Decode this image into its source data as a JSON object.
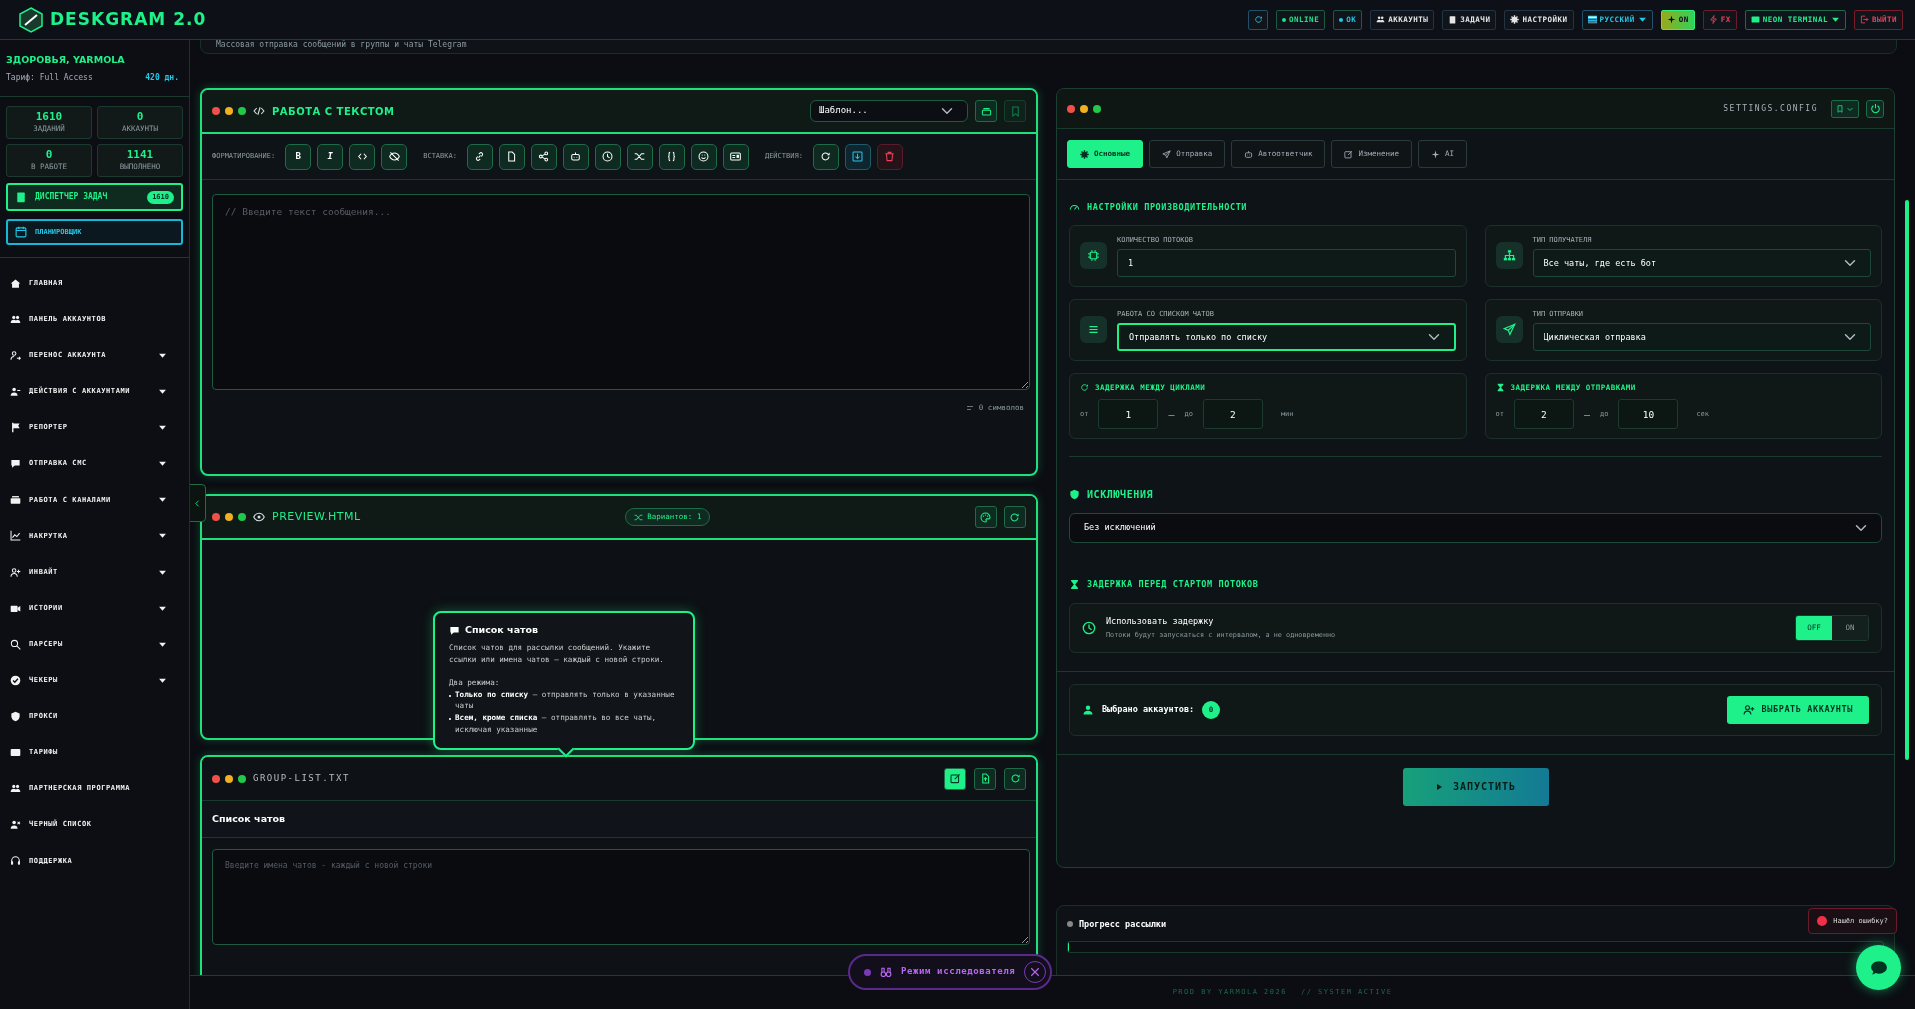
{
  "app": {
    "title": "DESKGRAM 2.0"
  },
  "topbar": [
    {
      "kind": "icon"
    },
    {
      "kind": "status",
      "label": "ONLINE",
      "color": "#22e08a"
    },
    {
      "kind": "status",
      "label": "OK",
      "color": "#22c8e8"
    },
    {
      "kind": "nav",
      "label": "АККАУНТЫ"
    },
    {
      "kind": "nav",
      "label": "ЗАДАЧИ"
    },
    {
      "kind": "nav",
      "label": "НАСТРОЙКИ"
    },
    {
      "kind": "language",
      "label": "РУССКИЙ"
    },
    {
      "kind": "effects",
      "label": "ON"
    },
    {
      "kind": "fx",
      "label": "FX"
    },
    {
      "kind": "theme",
      "label": "NEON TERMINAL"
    },
    {
      "kind": "logout",
      "label": "ВЫЙТИ"
    }
  ],
  "sidebar": {
    "greeting": "ЗДОРОВЬЯ, YARMOLA",
    "plan": "Тариф: Full Access",
    "days": "420 дн.",
    "stats": [
      {
        "value": "1610",
        "label": "ЗАДАНИЙ"
      },
      {
        "value": "0",
        "label": "АККАУНТЫ"
      },
      {
        "value": "0",
        "label": "В РАБОТЕ"
      },
      {
        "value": "1141",
        "label": "ВЫПОЛНЕНО"
      }
    ],
    "task_manager": {
      "label": "ДИСПЕТЧЕР ЗАДАЧ",
      "count": "1610"
    },
    "scheduler": {
      "label": "ПЛАНИРОВЩИК"
    },
    "items": [
      {
        "label": "ГЛАВНАЯ",
        "expandable": false
      },
      {
        "label": "ПАНЕЛЬ АККАУНТОВ",
        "expandable": false
      },
      {
        "label": "ПЕРЕНОС АККАУНТА",
        "expandable": true
      },
      {
        "label": "ДЕЙСТВИЯ С АККАУНТАМИ",
        "expandable": true
      },
      {
        "label": "РЕПОРТЕР",
        "expandable": true
      },
      {
        "label": "ОТПРАВКА СМС",
        "expandable": true
      },
      {
        "label": "РАБОТА С КАНАЛАМИ",
        "expandable": true
      },
      {
        "label": "НАКРУТКА",
        "expandable": true
      },
      {
        "label": "ИНВАЙТ",
        "expandable": true
      },
      {
        "label": "ИСТОРИИ",
        "expandable": true
      },
      {
        "label": "ПАРСЕРЫ",
        "expandable": true
      },
      {
        "label": "ЧЕКЕРЫ",
        "expandable": true
      },
      {
        "label": "ПРОКСИ",
        "expandable": false
      },
      {
        "label": "ТАРИФЫ",
        "expandable": false
      },
      {
        "label": "ПАРТНЕРСКАЯ ПРОГРАММА",
        "expandable": false
      },
      {
        "label": "ЧЕРНЫЙ СПИСОК",
        "expandable": false
      },
      {
        "label": "ПОДДЕРЖКА",
        "expandable": false
      }
    ]
  },
  "page_header": {
    "subtitle": "Массовая отправка сообщений в группы и чаты Telegram"
  },
  "text_panel": {
    "title": "РАБОТА С ТЕКСТОМ",
    "template": "Шаблон...",
    "groups": [
      {
        "label": "ФОРМАТИРОВАНИЕ:",
        "buttons": [
          {
            "kind": "text",
            "label": "B"
          },
          {
            "kind": "text",
            "label": "I"
          },
          {
            "kind": "icon"
          },
          {
            "kind": "icon"
          }
        ]
      },
      {
        "label": "ВСТАВКА:",
        "buttons": [
          {
            "kind": "icon"
          },
          {
            "kind": "icon"
          },
          {
            "kind": "icon"
          },
          {
            "kind": "icon"
          },
          {
            "kind": "icon"
          },
          {
            "kind": "icon"
          },
          {
            "kind": "icon"
          },
          {
            "kind": "icon"
          },
          {
            "kind": "icon"
          }
        ]
      },
      {
        "label": "ДЕЙСТВИЯ:",
        "buttons": [
          {
            "kind": "icon"
          },
          {
            "kind": "icon"
          },
          {
            "kind": "icon"
          }
        ]
      }
    ],
    "placeholder": "// Введите текст сообщения...",
    "counter": "0 символов"
  },
  "preview_panel": {
    "title": "PREVIEW.HTML",
    "variants": "Вариантов: 1"
  },
  "group_list": {
    "title": "GROUP-LIST.TXT",
    "tools": [
      {
        "active": true
      },
      {
        "active": false
      },
      {
        "active": false
      }
    ],
    "heading": "Список чатов",
    "placeholder": "Введите имена чатов - каждый с новой строки"
  },
  "tooltip": {
    "title": "Список чатов",
    "text": "Список чатов для рассылки сообщений. Укажите ссылки или имена чатов — каждый с новой строки.",
    "modes_title": "Два режима:",
    "modes": [
      "**Только по списку** — отправлять только в указанные чаты",
      "**Всем, кроме списка** — отправлять во все чаты, исключая указанные"
    ]
  },
  "settings": {
    "title": "SETTINGS.CONFIG",
    "tabs": [
      {
        "label": "Основные",
        "selected": true
      },
      {
        "label": "Отправка",
        "selected": false
      },
      {
        "label": "Автоответчик",
        "selected": false
      },
      {
        "label": "Изменение",
        "selected": false
      },
      {
        "label": "AI",
        "selected": false
      }
    ],
    "performance_title": "НАСТРОЙКИ ПРОИЗВОДИТЕЛЬНОСТИ",
    "fields": [
      {
        "kind": "input",
        "label": "КОЛИЧЕСТВО ПОТОКОВ",
        "value": "1",
        "focused": false
      },
      {
        "kind": "select",
        "label": "ТИП ПОЛУЧАТЕЛЯ",
        "value": "Все чаты, где есть бот",
        "focused": false
      },
      {
        "kind": "select",
        "label": "РАБОТА СО СПИСКОМ ЧАТОВ",
        "value": "Отправлять только по списку",
        "focused": true
      },
      {
        "kind": "select",
        "label": "ТИП ОТПРАВКИ",
        "value": "Циклическая отправка",
        "focused": false
      }
    ],
    "delays": [
      {
        "title": "ЗАДЕРЖКА МЕЖДУ ЦИКЛАМИ",
        "from_label": "от",
        "from": "1",
        "separator": "—",
        "to_label": "до",
        "to": "2",
        "unit": "мин"
      },
      {
        "title": "ЗАДЕРЖКА МЕЖДУ ОТПРАВКАМИ",
        "from_label": "от",
        "from": "2",
        "separator": "—",
        "to_label": "до",
        "to": "10",
        "unit": "сек"
      }
    ],
    "exclusions_title": "ИСКЛЮЧЕНИЯ",
    "exclusions": "Без исключений",
    "start_delay": {
      "title": "ЗАДЕРЖКА ПЕРЕД СТАРТОМ ПОТОКОВ",
      "label": "Использовать задержку",
      "description": "Потоки будут запускаться с интервалом, а не одновременно",
      "off_label": "OFF",
      "on_label": "ON",
      "on": false
    },
    "accounts": {
      "label": "Выбрано аккаунтов:",
      "count": "0",
      "button": "ВЫБРАТЬ АККАУНТЫ"
    },
    "run": "ЗАПУСТИТЬ"
  },
  "progress": {
    "title": "Прогресс рассылки",
    "level": 0
  },
  "bug_report": "Нашёл ошибку?",
  "researcher_mode": "Режим исследователя",
  "footer": {
    "credit": "PROD BY YARMOLA 2026",
    "status": "// SYSTEM ACTIVE"
  }
}
